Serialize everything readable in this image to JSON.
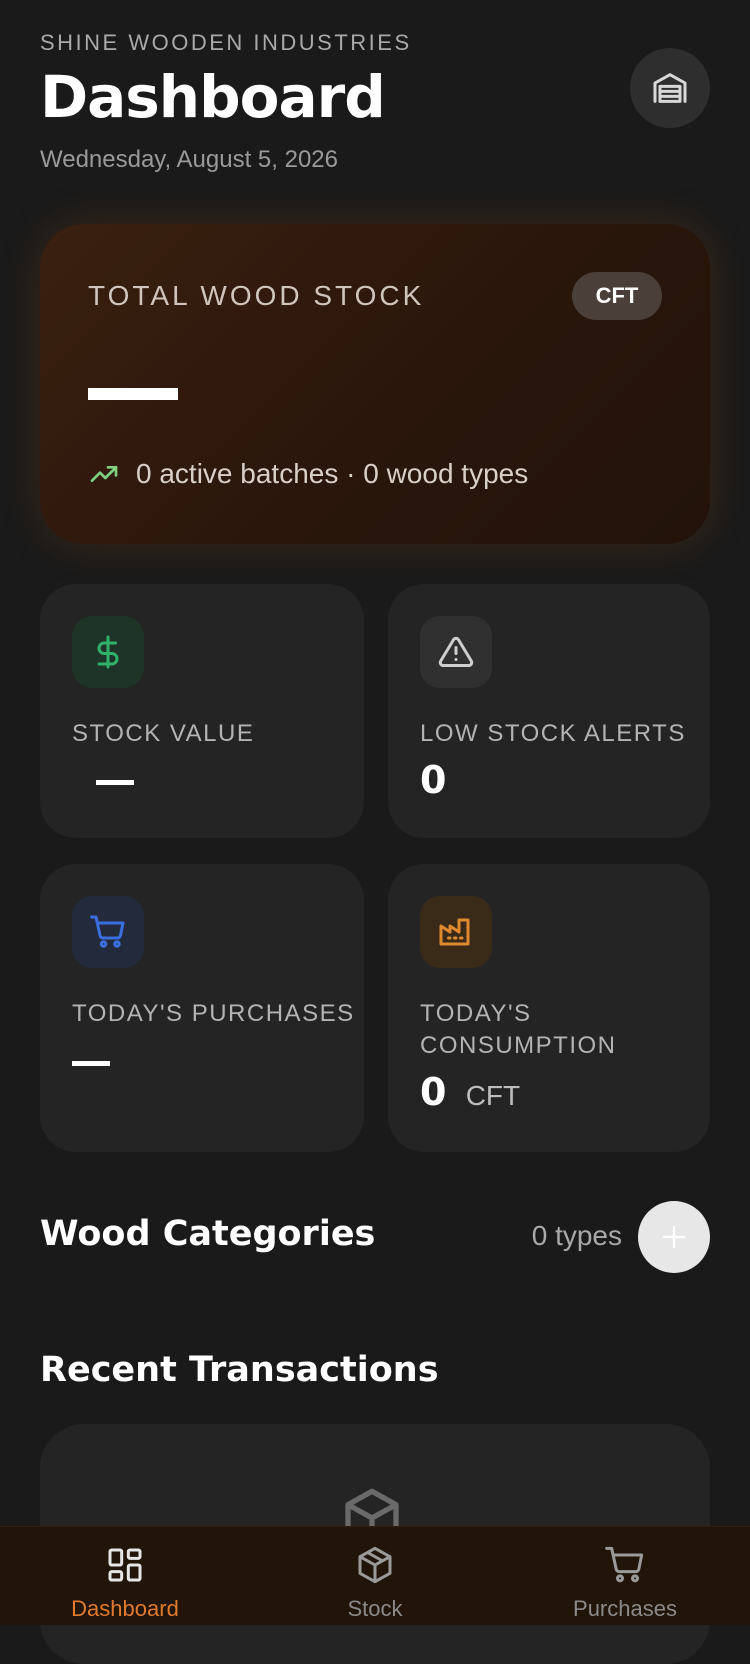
{
  "header": {
    "company": "SHINE WOODEN INDUSTRIES",
    "title": "Dashboard",
    "date": "Wednesday, August 5, 2026"
  },
  "hero": {
    "label": "TOTAL WOOD STOCK",
    "unit_badge": "CFT",
    "summary": "0 active batches · 0 wood types"
  },
  "cards": {
    "stock_value": {
      "label": "STOCK VALUE"
    },
    "low_stock": {
      "label": "LOW STOCK ALERTS",
      "value": "0"
    },
    "purchases": {
      "label": "TODAY'S PURCHASES"
    },
    "consumption": {
      "label_line1": "TODAY'S",
      "label_line2": "CONSUMPTION",
      "value": "0",
      "unit": "CFT"
    }
  },
  "categories": {
    "title": "Wood Categories",
    "count": "0 types"
  },
  "transactions": {
    "title": "Recent Transactions"
  },
  "nav": {
    "items": [
      {
        "label": "Dashboard",
        "icon": "dashboard-grid-icon",
        "active": true
      },
      {
        "label": "Stock",
        "icon": "box-icon",
        "active": false
      },
      {
        "label": "Purchases",
        "icon": "cart-icon",
        "active": false
      }
    ]
  },
  "colors": {
    "accent": "#e07a2e",
    "green": "#2fb36a",
    "blue": "#3b6fe0",
    "orange": "#e08a2e"
  }
}
